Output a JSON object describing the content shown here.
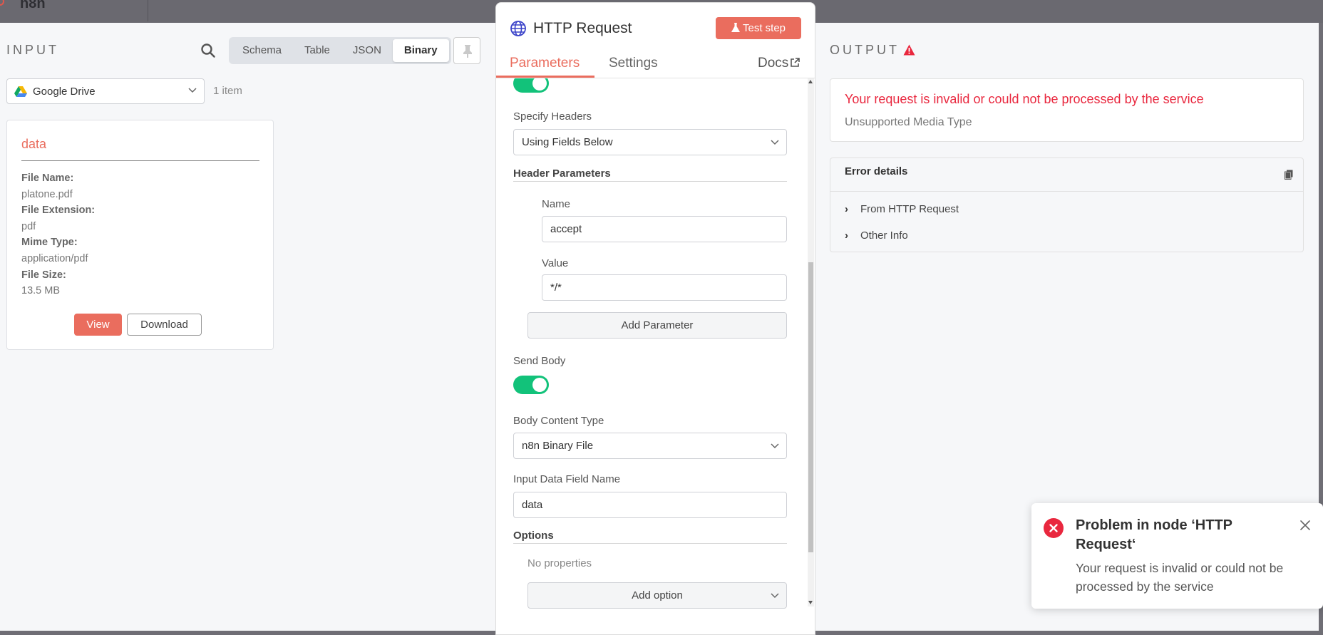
{
  "app": {
    "logo": "n8n"
  },
  "input": {
    "title": "INPUT",
    "view_tabs": [
      "Schema",
      "Table",
      "JSON",
      "Binary"
    ],
    "active_tab": "Binary",
    "node_select": "Google Drive",
    "item_count": "1 item",
    "binary": {
      "name": "data",
      "fields": [
        {
          "key": "File Name:",
          "value": "platone.pdf"
        },
        {
          "key": "File Extension:",
          "value": "pdf"
        },
        {
          "key": "Mime Type:",
          "value": "application/pdf"
        },
        {
          "key": "File Size:",
          "value": "13.5 MB"
        }
      ],
      "view_label": "View",
      "download_label": "Download"
    }
  },
  "modal": {
    "title": "HTTP Request",
    "test_label": "Test step",
    "tabs": [
      "Parameters",
      "Settings"
    ],
    "active_tab": "Parameters",
    "docs_label": "Docs",
    "specify_headers_label": "Specify Headers",
    "specify_headers_value": "Using Fields Below",
    "header_params_label": "Header Parameters",
    "header_name_label": "Name",
    "header_name_value": "accept",
    "header_value_label": "Value",
    "header_value_value": "*/*",
    "add_parameter_label": "Add Parameter",
    "send_body_label": "Send Body",
    "body_content_type_label": "Body Content Type",
    "body_content_type_value": "n8n Binary File",
    "input_field_label": "Input Data Field Name",
    "input_field_value": "data",
    "options_label": "Options",
    "no_properties": "No properties",
    "add_option_label": "Add option"
  },
  "output": {
    "title": "OUTPUT",
    "error_title": "Your request is invalid or could not be processed by the service",
    "error_subtitle": "Unsupported Media Type",
    "details_title": "Error details",
    "details_rows": [
      "From HTTP Request",
      "Other Info"
    ]
  },
  "toast": {
    "title": "Problem in node ‘HTTP Request‘",
    "message": "Your request is invalid or could not be processed by the service"
  },
  "colors": {
    "accent": "#ea6d5e",
    "error": "#e9273e",
    "toggle_on": "#12c27a"
  }
}
